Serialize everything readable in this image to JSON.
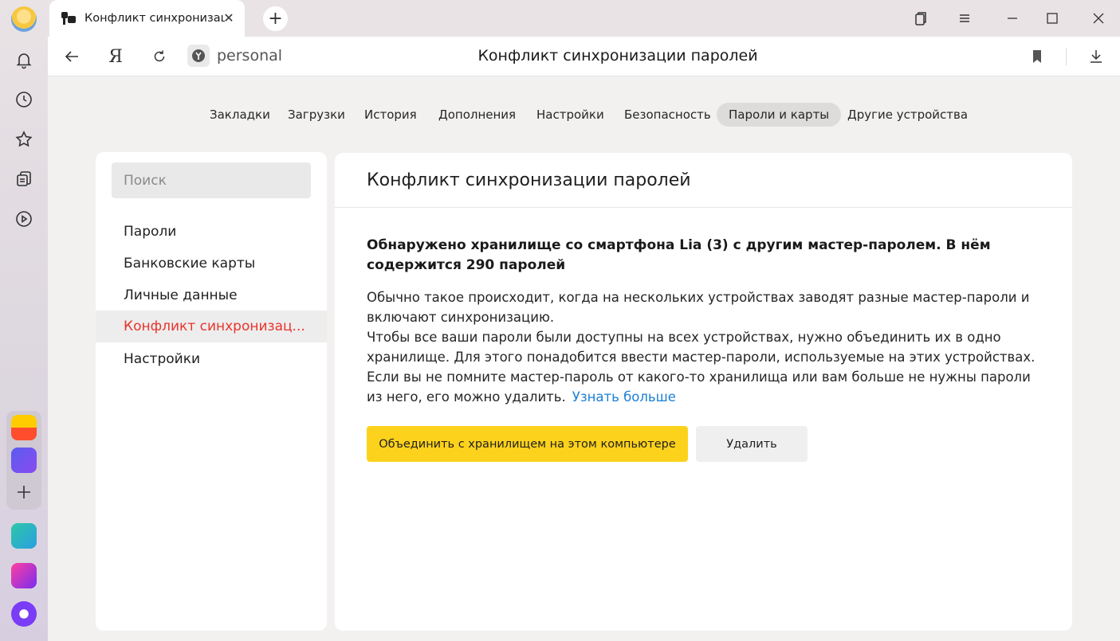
{
  "tab": {
    "title": "Конфликт синхронизац",
    "close": "✕",
    "new": "+"
  },
  "address": {
    "yandex_letter": "Я",
    "site": "personal",
    "page_title": "Конфликт синхронизации паролей"
  },
  "nav": [
    {
      "label": "Закладки"
    },
    {
      "label": "Загрузки"
    },
    {
      "label": "История"
    },
    {
      "label": "Дополнения"
    },
    {
      "label": "Настройки"
    },
    {
      "label": "Безопасность"
    },
    {
      "label": "Пароли и карты"
    },
    {
      "label": "Другие устройства"
    }
  ],
  "sidebar": {
    "search_placeholder": "Поиск",
    "items": [
      {
        "label": "Пароли"
      },
      {
        "label": "Банковские карты"
      },
      {
        "label": "Личные данные"
      },
      {
        "label": "Конфликт синхронизац..."
      },
      {
        "label": "Настройки"
      }
    ]
  },
  "main": {
    "title": "Конфликт синхронизации паролей",
    "headline": "Обнаружено хранилище со смартфона Lia (3) с другим мастер-паролем. В нём содержится 290 паролей",
    "para1": "Обычно такое происходит, когда на нескольких устройствах заводят разные мастер-пароли и включают синхронизацию.",
    "para2": "Чтобы все ваши пароли были доступны на всех устройствах, нужно объединить их в одно хранилище. Для этого понадобится ввести мастер-пароли, используемые на этих устройствах.",
    "para3": "Если вы не помните мастер-пароль от какого-то хранилища или вам больше не нужны пароли из него, его можно удалить.",
    "learn_more": "Узнать больше",
    "merge_button": "Объединить с хранилищем на этом компьютере",
    "delete_button": "Удалить"
  },
  "colors": {
    "accent_yellow": "#fdd21c",
    "active_red": "#e8352c",
    "link_blue": "#1c7fd6"
  }
}
